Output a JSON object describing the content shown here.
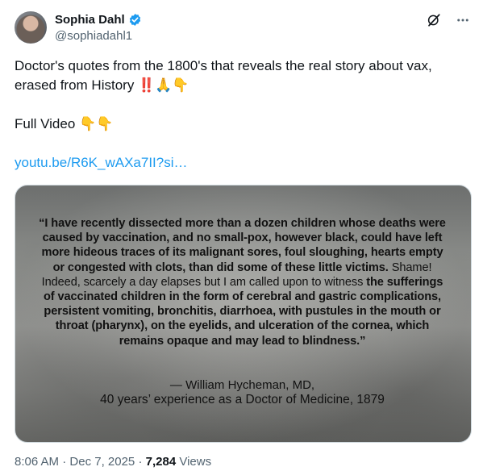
{
  "author": {
    "display_name": "Sophia Dahl",
    "handle": "@sophiadahl1"
  },
  "tweet": {
    "line1": "Doctor's quotes from the 1800's that reveals the real story about vax,",
    "line2": "erased from History ‼️🙏👇",
    "line3": "Full Video 👇👇",
    "link_text": "youtu.be/R6K_wAXa7II?si…"
  },
  "media": {
    "quote_part1": "“I have recently dissected more than a dozen children whose deaths were caused by vaccination, and no small-pox, however black, could have left more hideous traces of its malignant sores, foul sloughing, hearts empty or congested with clots, than did some of these little victims.",
    "quote_part2": " Shame! Indeed, scarcely a day elapses but I am called upon to witness ",
    "quote_part3": "the sufferings of vaccinated children in the form of cerebral and gastric complications, persistent vomiting, bronchitis, diarrhoea, with pustules in the mouth or throat (pharynx), on the eyelids, and ulceration of the cornea, which remains opaque and may lead to blindness.”",
    "attribution_name": "— William Hycheman, MD,",
    "attribution_detail": "40 years’ experience as a Doctor of Medicine, 1879"
  },
  "meta": {
    "time": "8:06 AM",
    "separator": " · ",
    "date": "Dec 7, 2025",
    "views_count": "7,284",
    "views_label": " Views"
  },
  "icons": {
    "verified": "verified-badge-icon",
    "grok": "grok-icon",
    "more": "more-icon"
  },
  "colors": {
    "accent": "#1d9bf0",
    "secondary_text": "#536471"
  }
}
